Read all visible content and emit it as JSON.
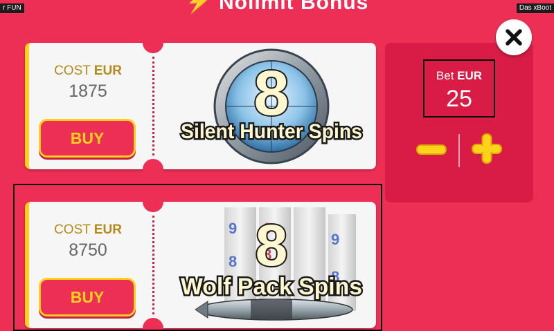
{
  "header": {
    "title": "Nolimit Bonus",
    "left_tag": "r FUN",
    "right_tag": "Das xBoot"
  },
  "bonuses": [
    {
      "cost_label": "COST",
      "currency": "EUR",
      "cost": "1875",
      "buy_label": "BUY",
      "count": "8",
      "name": "Silent Hunter Spins",
      "selected": false
    },
    {
      "cost_label": "COST",
      "currency": "EUR",
      "cost": "8750",
      "buy_label": "BUY",
      "count": "8",
      "name": "Wolf Pack Spins",
      "selected": true
    }
  ],
  "bet": {
    "label": "Bet",
    "currency": "EUR",
    "value": "25"
  },
  "icons": [
    "lightning-icon",
    "close-icon",
    "minus-icon",
    "plus-icon"
  ],
  "colors": {
    "background": "#ee2f55",
    "accent_yellow": "#ffce1f",
    "cost_gold": "#b58a1b",
    "panel": "#d81c46"
  }
}
